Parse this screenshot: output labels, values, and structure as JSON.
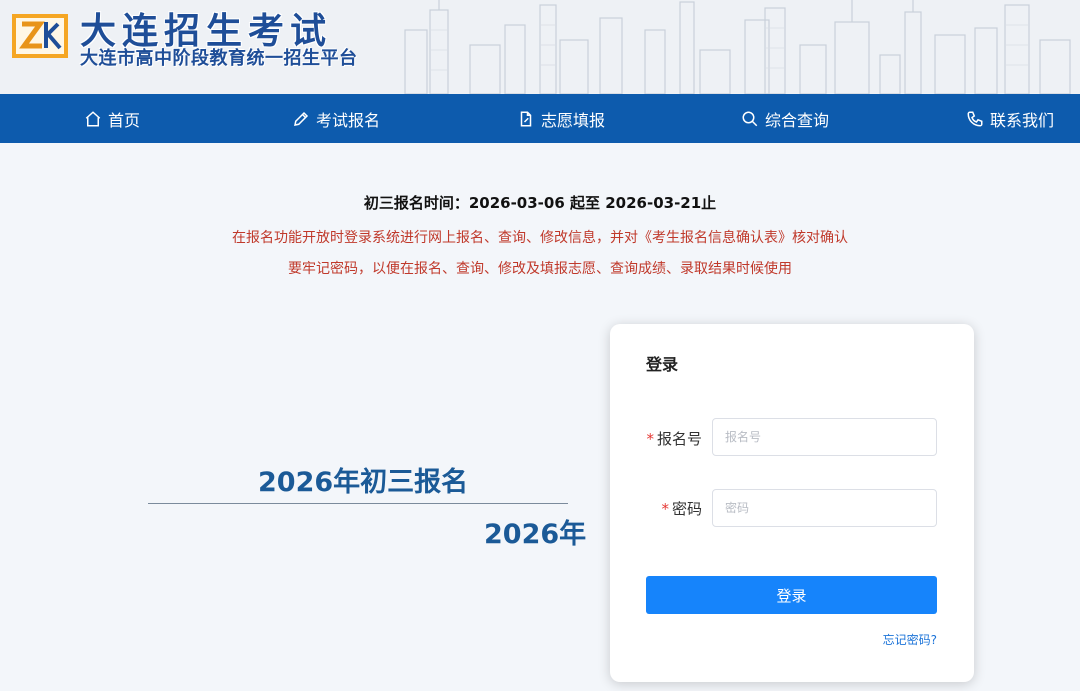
{
  "header": {
    "title": "大连招生考试",
    "subtitle": "大连市高中阶段教育统一招生平台",
    "brand_color": "#1f4e98"
  },
  "nav": {
    "background": "#0d5bad",
    "items": [
      {
        "label": "首页",
        "icon": "home-icon"
      },
      {
        "label": "考试报名",
        "icon": "pencil-icon"
      },
      {
        "label": "志愿填报",
        "icon": "document-edit-icon"
      },
      {
        "label": "综合查询",
        "icon": "search-icon"
      },
      {
        "label": "联系我们",
        "icon": "phone-icon"
      }
    ]
  },
  "notice": {
    "title": "初三报名时间：2026-03-06 起至 2026-03-21止",
    "line1": "在报名功能开放时登录系统进行网上报名、查询、修改信息，并对《考生报名信息确认表》核对确认",
    "line2": "要牢记密码，以便在报名、查询、修改及填报志愿、查询成绩、录取结果时候使用",
    "alert_color": "#c0392b"
  },
  "promo": {
    "title": "2026年初三报名",
    "year": "2026年"
  },
  "login": {
    "title": "登录",
    "fields": [
      {
        "label": "报名号",
        "required": true,
        "placeholder": "报名号",
        "value": ""
      },
      {
        "label": "密码",
        "required": true,
        "placeholder": "密码",
        "value": ""
      }
    ],
    "required_mark": "*",
    "submit_label": "登录",
    "forgot_label": "忘记密码?",
    "button_color": "#1684fb"
  }
}
